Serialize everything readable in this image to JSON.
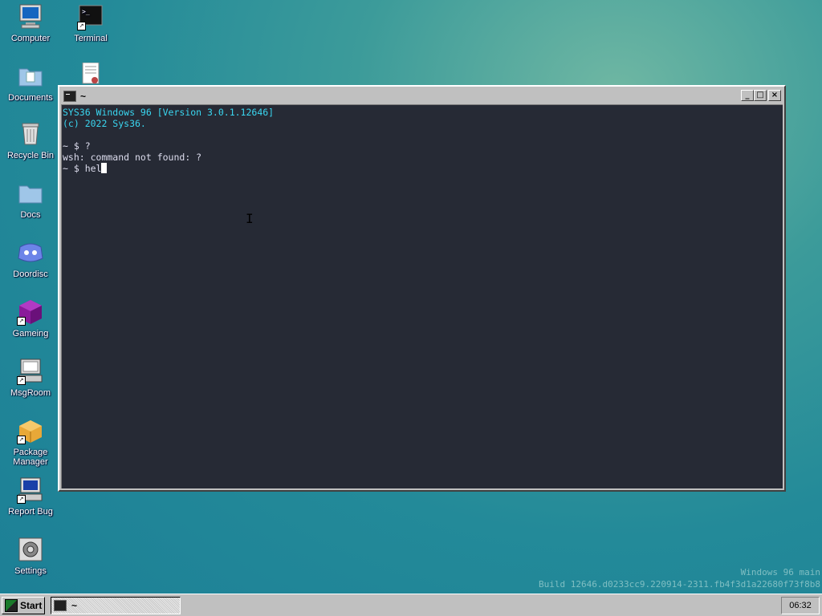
{
  "desktop": {
    "icons": [
      {
        "label": "Computer",
        "icon": "computer-icon"
      },
      {
        "label": "Terminal",
        "icon": "terminal-icon"
      },
      {
        "label": "Documents",
        "icon": "documents-folder-icon"
      },
      {
        "label": "",
        "icon": "text-file-icon"
      },
      {
        "label": "Recycle Bin",
        "icon": "recycle-bin-icon"
      },
      {
        "label": "Docs",
        "icon": "docs-folder-icon"
      },
      {
        "label": "Doordisc",
        "icon": "doordisc-icon"
      },
      {
        "label": "Gameing",
        "icon": "gameing-icon"
      },
      {
        "label": "MsgRoom",
        "icon": "msgroom-icon"
      },
      {
        "label": "Package Manager",
        "icon": "package-manager-icon"
      },
      {
        "label": "Report Bug",
        "icon": "report-bug-icon"
      },
      {
        "label": "Settings",
        "icon": "settings-icon"
      }
    ]
  },
  "window": {
    "title": "~",
    "buttons": {
      "minimize": "_",
      "maximize": "□",
      "close": "×"
    },
    "terminal": {
      "lines": [
        "SYS36 Windows 96 [Version 3.0.1.12646]",
        "(c) 2022 Sys36.",
        "",
        "~ $ ?",
        "wsh: command not found: ?"
      ],
      "prompt": "~ $ ",
      "input": "hel"
    }
  },
  "watermark": {
    "line1": "Windows 96 main",
    "line2": "Build 12646.d0233cc9.220914-2311.fb4f3d1a22680f73f8b8"
  },
  "taskbar": {
    "start_label": "Start",
    "task_label": "~",
    "clock": "06:32"
  },
  "colors": {
    "terminal_bg": "#262a35",
    "terminal_cyan": "#3ad6f0",
    "chrome": "#c0c0c0"
  }
}
